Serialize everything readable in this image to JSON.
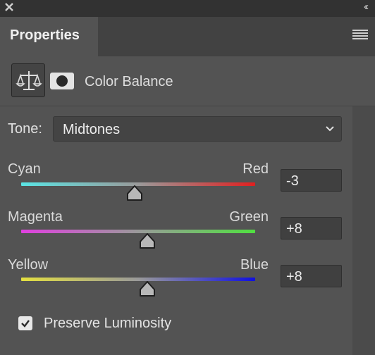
{
  "panel": {
    "tab_label": "Properties",
    "collapse_glyph": "‹‹"
  },
  "adjustment": {
    "icon": "balance-scale-icon",
    "mask_icon": "layer-mask-icon",
    "title": "Color Balance"
  },
  "tone": {
    "label": "Tone:",
    "selected": "Midtones"
  },
  "sliders": [
    {
      "left": "Cyan",
      "right": "Red",
      "value": "-3",
      "position_fraction": 0.485,
      "left_color": "#5ae4e4",
      "right_color": "#e02020"
    },
    {
      "left": "Magenta",
      "right": "Green",
      "value": "+8",
      "position_fraction": 0.54,
      "left_color": "#e040e0",
      "right_color": "#50e040"
    },
    {
      "left": "Yellow",
      "right": "Blue",
      "value": "+8",
      "position_fraction": 0.54,
      "left_color": "#e4e040",
      "right_color": "#1010e0"
    }
  ],
  "preserve_luminosity": {
    "label": "Preserve Luminosity",
    "checked": true
  }
}
